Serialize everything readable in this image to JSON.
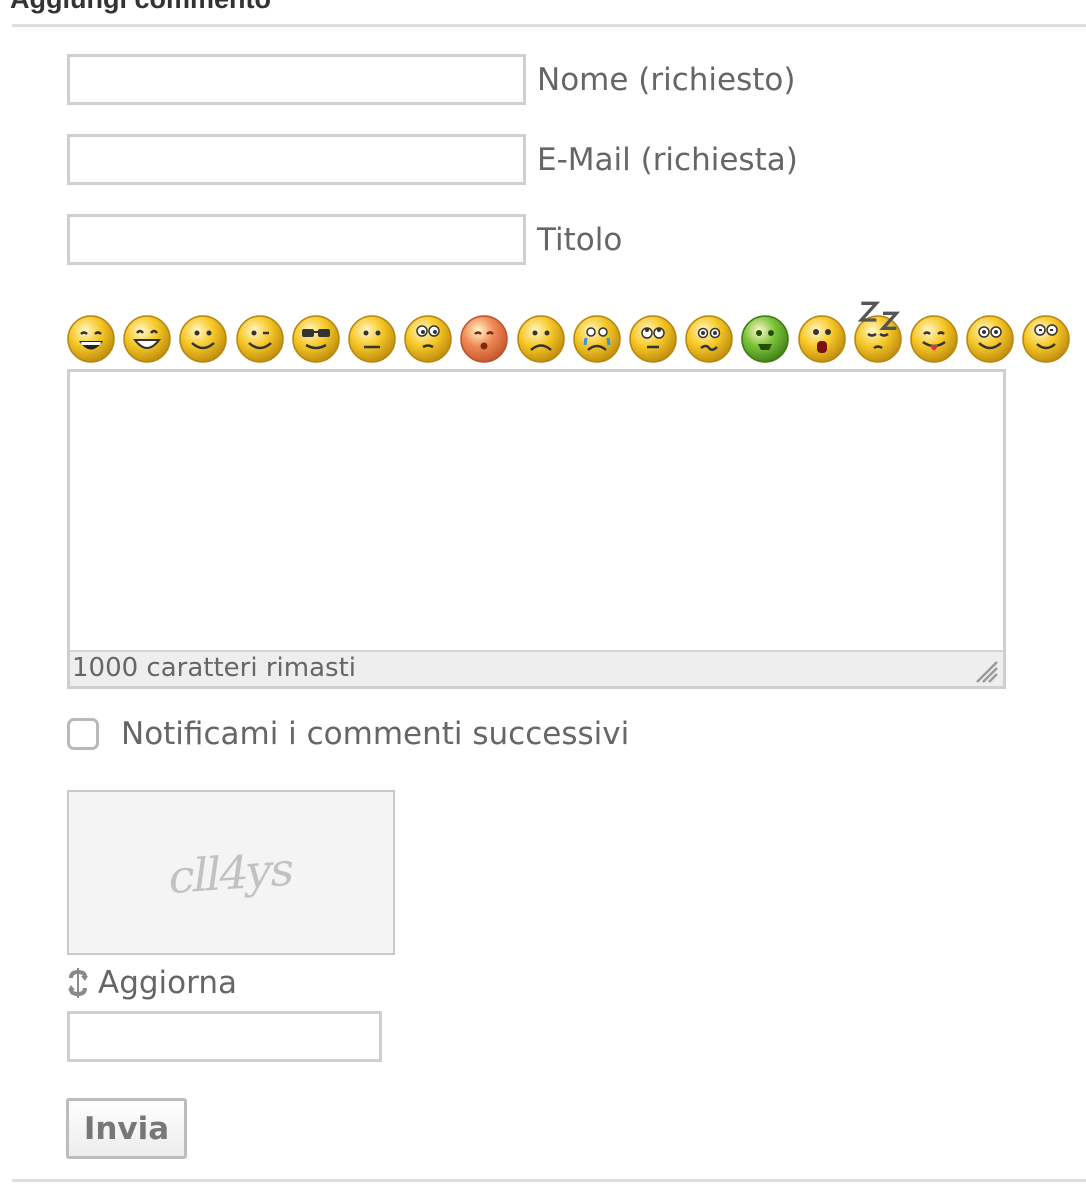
{
  "heading": "Aggiungi commento",
  "fields": {
    "name": {
      "label": "Nome (richiesto)",
      "value": ""
    },
    "email": {
      "label": "E-Mail (richiesta)",
      "value": ""
    },
    "title": {
      "label": "Titolo",
      "value": ""
    }
  },
  "smileys": [
    "laughing",
    "grin",
    "smile",
    "wink",
    "cool",
    "neutral",
    "thinking",
    "blush",
    "sad",
    "crying",
    "rolling-eyes",
    "confused",
    "sick",
    "shocked",
    "sleeping",
    "tongue",
    "happy-eyes",
    "winking-eyes"
  ],
  "comment": {
    "value": "",
    "counter": "1000 caratteri rimasti"
  },
  "notify": {
    "label": "Notificami i commenti successivi",
    "checked": false
  },
  "captcha": {
    "text": "cll4ys",
    "refresh_label": "Aggiorna",
    "value": ""
  },
  "submit_label": "Invia"
}
